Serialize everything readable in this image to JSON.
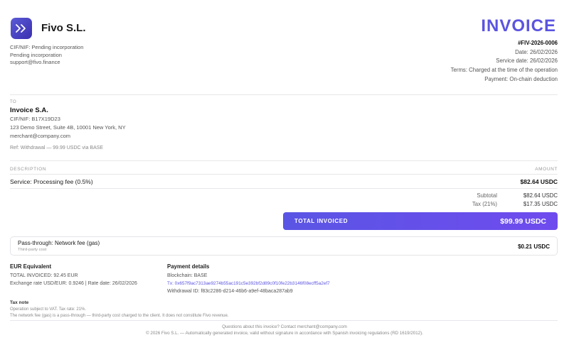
{
  "seller": {
    "name": "Fivo S.L.",
    "lines": [
      "CIF/NIF: Pending incorporation",
      "Pending incorporation",
      "support@fivo.finance"
    ]
  },
  "invoice": {
    "title": "INVOICE",
    "number": "#FIV-2026-0006",
    "date": "Date: 26/02/2026",
    "service_date": "Service date: 26/02/2026",
    "terms": "Terms: Charged at the time of the operation",
    "payment": "Payment: On-chain deduction"
  },
  "client": {
    "to_label": "TO",
    "name": "Invoice S.A.",
    "lines": [
      "CIF/NIF: B17X19D23",
      "123 Demo Street, Suite 4B, 10001 New York, NY",
      "merchant@company.com"
    ],
    "ref": "Ref: Withdrawal — 99.99 USDC via BASE"
  },
  "table": {
    "description_header": "DESCRIPTION",
    "amount_header": "AMOUNT",
    "line_description": "Service: Processing fee (0.5%)",
    "line_amount": "$82.64 USDC"
  },
  "summary": {
    "subtotal_label": "Subtotal",
    "subtotal_value": "$82.64 USDC",
    "tax_label": "Tax (21%)",
    "tax_value": "$17.35 USDC",
    "total_label": "TOTAL INVOICED",
    "total_value": "$99.99 USDC"
  },
  "pass_through": {
    "title": "Pass-through: Network fee (gas)",
    "subtitle": "Third-party cost",
    "amount": "$0.21 USDC"
  },
  "eur": {
    "heading": "EUR Equivalent",
    "total": "TOTAL INVOICED: 92.45 EUR",
    "rate": "Exchange rate USD/EUR: 0.9246 | Rate date: 26/02/2026"
  },
  "payment_details": {
    "heading": "Payment details",
    "blockchain": "Blockchain: BASE",
    "tx": "Tx: 0x657f9ac7313ae9274b55ac191c5e392bf2d89c0f10fe22b3146f08ecff5a2ef7",
    "withdrawal_id": "Withdrawal ID: f83c2286-d214-46b6-a9ef-48baca287ab9"
  },
  "tax_note": {
    "heading": "Tax note",
    "line1": "Operation subject to VAT. Tax rate: 21%.",
    "line2": "The network fee (gas) is a pass-through — third-party cost charged to the client. It does not constitute Fivo revenue."
  },
  "footer": {
    "questions": "Questions about this invoice? Contact merchant@company.com",
    "legal": "© 2026 Fivo S.L. — Automatically generated invoice, valid without signature in accordance with Spanish invoicing regulations (RD 1619/2012)."
  },
  "colors": {
    "accent": "#5b54e0",
    "total_bar_start": "#5a55e4",
    "total_bar_end": "#6f4bee"
  },
  "icons": {
    "logo": "fivo-logo-icon"
  }
}
